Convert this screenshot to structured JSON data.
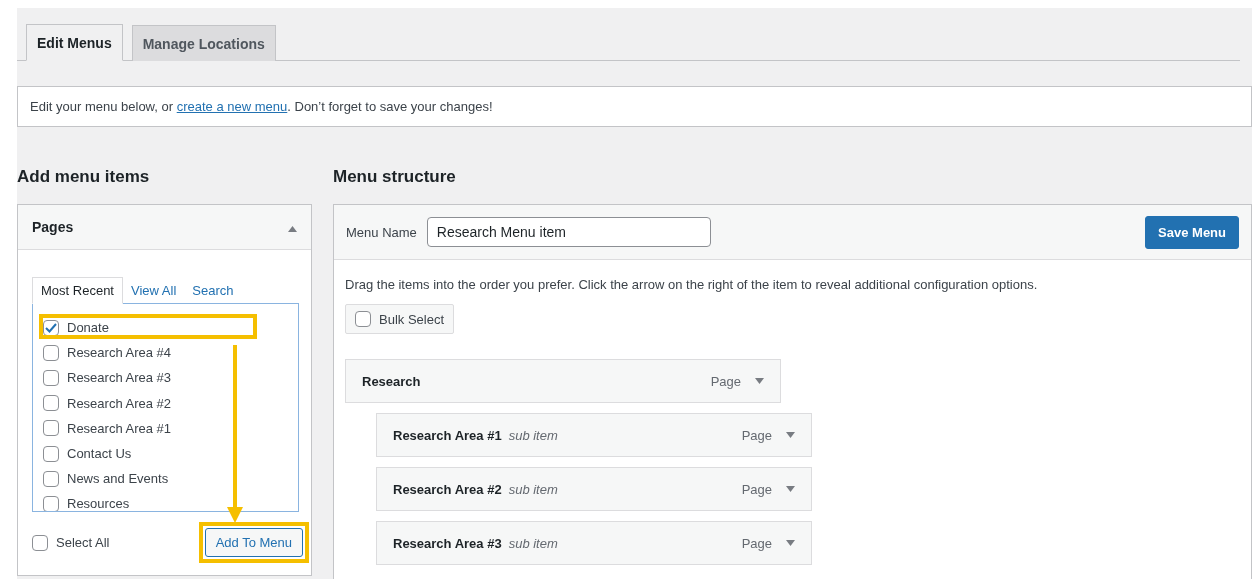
{
  "tabs": [
    {
      "label": "Edit Menus",
      "selected": true
    },
    {
      "label": "Manage Locations",
      "selected": false
    }
  ],
  "notice": {
    "text_before": "Edit your menu below, or ",
    "link": "create a new menu",
    "text_after": ". Don’t forget to save your changes!"
  },
  "add_items": {
    "heading": "Add menu items",
    "panel_title": "Pages",
    "expanded": true,
    "subtabs": [
      {
        "label": "Most Recent",
        "selected": true
      },
      {
        "label": "View All",
        "selected": false
      },
      {
        "label": "Search",
        "selected": false
      }
    ],
    "pages": [
      {
        "label": "Donate",
        "checked": true,
        "highlighted": true
      },
      {
        "label": "Research Area #4",
        "checked": false,
        "highlighted": false
      },
      {
        "label": "Research Area #3",
        "checked": false,
        "highlighted": false
      },
      {
        "label": "Research Area #2",
        "checked": false,
        "highlighted": false
      },
      {
        "label": "Research Area #1",
        "checked": false,
        "highlighted": false
      },
      {
        "label": "Contact Us",
        "checked": false,
        "highlighted": false
      },
      {
        "label": "News and Events",
        "checked": false,
        "highlighted": false
      },
      {
        "label": "Resources",
        "checked": false,
        "highlighted": false
      }
    ],
    "select_all": {
      "label": "Select All",
      "checked": false
    },
    "add_button": {
      "label": "Add To Menu",
      "highlighted": true
    }
  },
  "structure": {
    "heading": "Menu structure",
    "name_label": "Menu Name",
    "name_value": "Research Menu item",
    "save_button": "Save Menu",
    "instructions": "Drag the items into the order you prefer. Click the arrow on the right of the item to reveal additional configuration options.",
    "bulk_select": {
      "label": "Bulk Select",
      "checked": false
    },
    "items": [
      {
        "title": "Research",
        "type": "Page",
        "children": [
          {
            "title": "Research Area #1",
            "note": "sub item",
            "type": "Page"
          },
          {
            "title": "Research Area #2",
            "note": "sub item",
            "type": "Page"
          },
          {
            "title": "Research Area #3",
            "note": "sub item",
            "type": "Page"
          }
        ]
      }
    ]
  }
}
